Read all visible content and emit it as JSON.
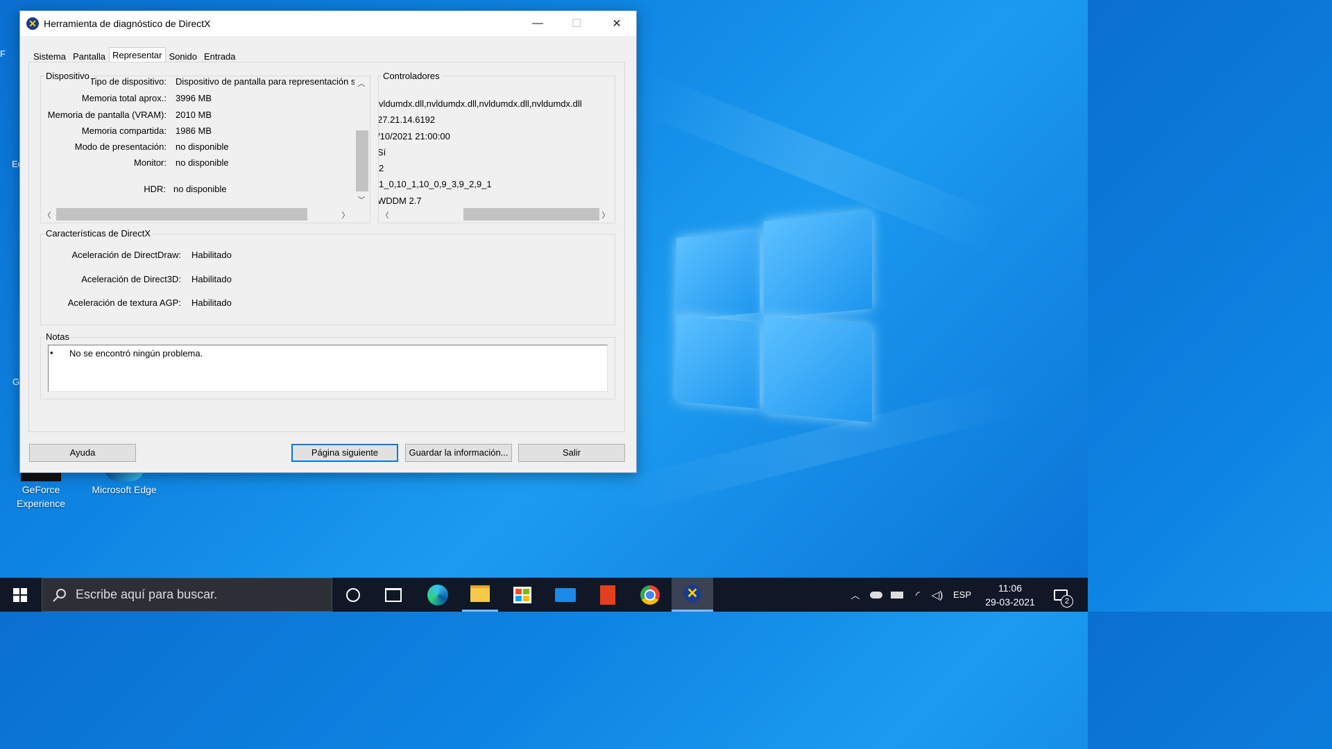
{
  "window": {
    "title": "Herramienta de diagnóstico de DirectX",
    "controls": {
      "minimize": "—",
      "maximize": "☐",
      "close": "✕"
    }
  },
  "tabs": [
    {
      "label": "Sistema"
    },
    {
      "label": "Pantalla"
    },
    {
      "label": "Representar",
      "active": true
    },
    {
      "label": "Sonido"
    },
    {
      "label": "Entrada"
    }
  ],
  "device": {
    "group_label": "Dispositivo",
    "rows": [
      {
        "label": "Tipo de dispositivo:",
        "value": "Dispositivo de pantalla para representación s"
      },
      {
        "label": "Memoria total aprox.:",
        "value": "3996 MB"
      },
      {
        "label": "Memoria de pantalla (VRAM):",
        "value": "2010 MB"
      },
      {
        "label": "Memoria compartida:",
        "value": "1986 MB"
      },
      {
        "label": "Modo de presentación:",
        "value": "no disponible"
      },
      {
        "label": "Monitor:",
        "value": "no disponible"
      },
      {
        "label": "HDR:",
        "value": "no disponible"
      }
    ]
  },
  "drivers": {
    "group_label": "Controladores",
    "values": [
      "vldumdx.dll,nvldumdx.dll,nvldumdx.dll,nvldumdx.dll",
      "27.21.14.6192",
      "/10/2021 21:00:00",
      "Sí",
      "2",
      "1_0,10_1,10_0,9_3,9_2,9_1",
      "WDDM 2.7"
    ]
  },
  "features": {
    "group_label": "Características de DirectX",
    "rows": [
      {
        "label": "Aceleración de DirectDraw:",
        "value": "Habilitado"
      },
      {
        "label": "Aceleración de Direct3D:",
        "value": "Habilitado"
      },
      {
        "label": "Aceleración de textura AGP:",
        "value": "Habilitado"
      }
    ]
  },
  "notes": {
    "group_label": "Notas",
    "items": [
      "No se encontró ningún problema."
    ]
  },
  "buttons": {
    "help": "Ayuda",
    "next_page": "Página siguiente",
    "save_info": "Guardar la información...",
    "exit": "Salir"
  },
  "desktop_icons": [
    {
      "label": "GeForce Experience"
    },
    {
      "label": "Microsoft Edge"
    }
  ],
  "taskbar": {
    "search_placeholder": "Escribe aquí para buscar.",
    "apps": [
      "cortana-icon",
      "task-view-icon",
      "edge-icon",
      "file-explorer-icon",
      "store-icon",
      "mail-icon",
      "office-icon",
      "chrome-icon",
      "dxdiag-icon"
    ],
    "language": "ESP",
    "time": "11:06",
    "date": "29-03-2021",
    "notifications_count": "2"
  }
}
